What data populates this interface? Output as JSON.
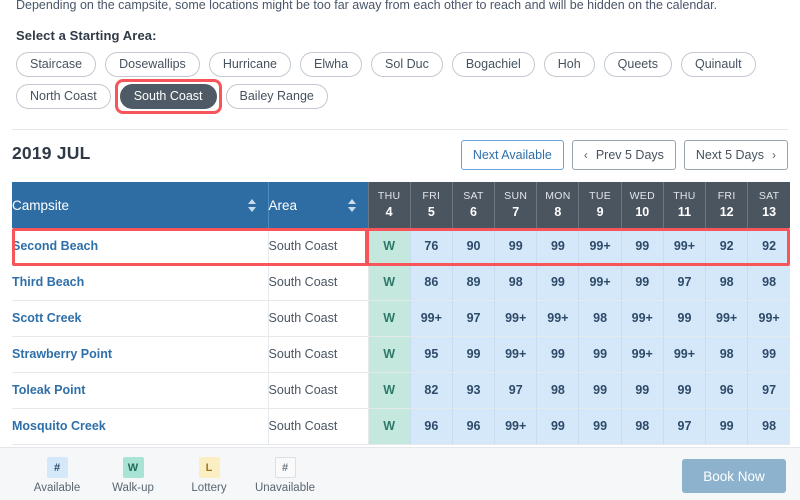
{
  "intro_note": "Depending on the campsite, some locations might be too far away from each other to reach and will be hidden on the calendar.",
  "area_selector": {
    "label": "Select a Starting Area:",
    "selected": "South Coast",
    "options": [
      "Staircase",
      "Dosewallips",
      "Hurricane",
      "Elwha",
      "Sol Duc",
      "Bogachiel",
      "Hoh",
      "Queets",
      "Quinault",
      "North Coast",
      "South Coast",
      "Bailey Range"
    ]
  },
  "calendar": {
    "month_title": "2019 JUL",
    "nav": {
      "next_available": "Next Available",
      "prev_5_days": "Prev 5 Days",
      "next_5_days": "Next 5 Days",
      "prev_chevron": "‹",
      "next_chevron": "›"
    },
    "columns": {
      "campsite": "Campsite",
      "area": "Area"
    },
    "days": [
      {
        "dow": "THU",
        "num": "4"
      },
      {
        "dow": "FRI",
        "num": "5"
      },
      {
        "dow": "SAT",
        "num": "6"
      },
      {
        "dow": "SUN",
        "num": "7"
      },
      {
        "dow": "MON",
        "num": "8"
      },
      {
        "dow": "TUE",
        "num": "9"
      },
      {
        "dow": "WED",
        "num": "10"
      },
      {
        "dow": "THU",
        "num": "11"
      },
      {
        "dow": "FRI",
        "num": "12"
      },
      {
        "dow": "SAT",
        "num": "13"
      }
    ],
    "rows": [
      {
        "campsite": "Second Beach",
        "area": "South Coast",
        "highlighted": true,
        "cells": [
          {
            "value": "W",
            "state": "walkup"
          },
          {
            "value": "76",
            "state": "available"
          },
          {
            "value": "90",
            "state": "available"
          },
          {
            "value": "99",
            "state": "available"
          },
          {
            "value": "99",
            "state": "available"
          },
          {
            "value": "99+",
            "state": "available"
          },
          {
            "value": "99",
            "state": "available"
          },
          {
            "value": "99+",
            "state": "available"
          },
          {
            "value": "92",
            "state": "available"
          },
          {
            "value": "92",
            "state": "available"
          }
        ]
      },
      {
        "campsite": "Third Beach",
        "area": "South Coast",
        "highlighted": false,
        "cells": [
          {
            "value": "W",
            "state": "walkup"
          },
          {
            "value": "86",
            "state": "available"
          },
          {
            "value": "89",
            "state": "available"
          },
          {
            "value": "98",
            "state": "available"
          },
          {
            "value": "99",
            "state": "available"
          },
          {
            "value": "99+",
            "state": "available"
          },
          {
            "value": "99",
            "state": "available"
          },
          {
            "value": "97",
            "state": "available"
          },
          {
            "value": "98",
            "state": "available"
          },
          {
            "value": "98",
            "state": "available"
          }
        ]
      },
      {
        "campsite": "Scott Creek",
        "area": "South Coast",
        "highlighted": false,
        "cells": [
          {
            "value": "W",
            "state": "walkup"
          },
          {
            "value": "99+",
            "state": "available"
          },
          {
            "value": "97",
            "state": "available"
          },
          {
            "value": "99+",
            "state": "available"
          },
          {
            "value": "99+",
            "state": "available"
          },
          {
            "value": "98",
            "state": "available"
          },
          {
            "value": "99+",
            "state": "available"
          },
          {
            "value": "99",
            "state": "available"
          },
          {
            "value": "99+",
            "state": "available"
          },
          {
            "value": "99+",
            "state": "available"
          }
        ]
      },
      {
        "campsite": "Strawberry Point",
        "area": "South Coast",
        "highlighted": false,
        "cells": [
          {
            "value": "W",
            "state": "walkup"
          },
          {
            "value": "95",
            "state": "available"
          },
          {
            "value": "99",
            "state": "available"
          },
          {
            "value": "99+",
            "state": "available"
          },
          {
            "value": "99",
            "state": "available"
          },
          {
            "value": "99",
            "state": "available"
          },
          {
            "value": "99+",
            "state": "available"
          },
          {
            "value": "99+",
            "state": "available"
          },
          {
            "value": "98",
            "state": "available"
          },
          {
            "value": "99",
            "state": "available"
          }
        ]
      },
      {
        "campsite": "Toleak Point",
        "area": "South Coast",
        "highlighted": false,
        "cells": [
          {
            "value": "W",
            "state": "walkup"
          },
          {
            "value": "82",
            "state": "available"
          },
          {
            "value": "93",
            "state": "available"
          },
          {
            "value": "97",
            "state": "available"
          },
          {
            "value": "98",
            "state": "available"
          },
          {
            "value": "99",
            "state": "available"
          },
          {
            "value": "99",
            "state": "available"
          },
          {
            "value": "99",
            "state": "available"
          },
          {
            "value": "96",
            "state": "available"
          },
          {
            "value": "97",
            "state": "available"
          }
        ]
      },
      {
        "campsite": "Mosquito Creek",
        "area": "South Coast",
        "highlighted": false,
        "cells": [
          {
            "value": "W",
            "state": "walkup"
          },
          {
            "value": "96",
            "state": "available"
          },
          {
            "value": "96",
            "state": "available"
          },
          {
            "value": "99+",
            "state": "available"
          },
          {
            "value": "99",
            "state": "available"
          },
          {
            "value": "99",
            "state": "available"
          },
          {
            "value": "98",
            "state": "available"
          },
          {
            "value": "97",
            "state": "available"
          },
          {
            "value": "99",
            "state": "available"
          },
          {
            "value": "98",
            "state": "available"
          }
        ]
      }
    ]
  },
  "footer": {
    "legend": [
      {
        "glyph": "#",
        "label": "Available",
        "state": "available"
      },
      {
        "glyph": "W",
        "label": "Walk-up",
        "state": "walkup"
      },
      {
        "glyph": "L",
        "label": "Lottery",
        "state": "lottery"
      },
      {
        "glyph": "#",
        "label": "Unavailable",
        "state": "unavail"
      }
    ],
    "book_now": "Book Now"
  },
  "colors": {
    "header_blue": "#2e6da4",
    "header_slate": "#4b5560",
    "available_cell": "#d5e8fa",
    "walkup_cell": "#c5e8de",
    "lottery_cell": "#fbeec2",
    "highlight_red": "#f8555b",
    "selected_pill": "#4e5a65",
    "book_now_blue": "#8cb2ce",
    "link_blue": "#2f6fa8"
  }
}
